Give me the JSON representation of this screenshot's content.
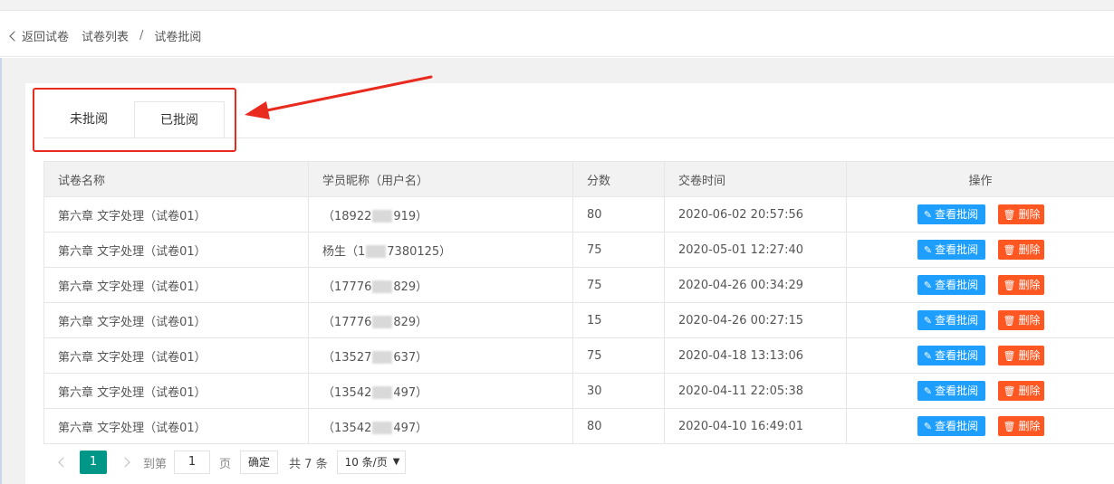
{
  "breadcrumb": {
    "back": "返回试卷",
    "list": "试卷列表",
    "separator": "/",
    "current": "试卷批阅"
  },
  "tabs": [
    {
      "label": "未批阅",
      "active": false
    },
    {
      "label": "已批阅",
      "active": true
    }
  ],
  "colors": {
    "view_button": "#1e9fff",
    "delete_button": "#ff5722",
    "current_page": "#009688",
    "annotation": "#e82a1f"
  },
  "table": {
    "headers": [
      "试卷名称",
      "学员昵称（用户名）",
      "分数",
      "交卷时间",
      "操作"
    ],
    "view_label": "查看批阅",
    "delete_label": "删除",
    "view_icon": "pencil-icon",
    "delete_icon": "trash-icon",
    "rows": [
      {
        "name": "第六章 文字处理（试卷01）",
        "user_a": "（18922",
        "user_b": "919）",
        "score": "80",
        "time": "2020-06-02 20:57:56"
      },
      {
        "name": "第六章 文字处理（试卷01）",
        "user_a": "杨生（1",
        "user_b": "7380125）",
        "score": "75",
        "time": "2020-05-01 12:27:40"
      },
      {
        "name": "第六章 文字处理（试卷01）",
        "user_a": "（17776",
        "user_b": "829）",
        "score": "75",
        "time": "2020-04-26 00:34:29"
      },
      {
        "name": "第六章 文字处理（试卷01）",
        "user_a": "（17776",
        "user_b": "829）",
        "score": "15",
        "time": "2020-04-26 00:27:15"
      },
      {
        "name": "第六章 文字处理（试卷01）",
        "user_a": "（13527",
        "user_b": "637）",
        "score": "75",
        "time": "2020-04-18 13:13:06"
      },
      {
        "name": "第六章 文字处理（试卷01）",
        "user_a": "（13542",
        "user_b": "497）",
        "score": "30",
        "time": "2020-04-11 22:05:38"
      },
      {
        "name": "第六章 文字处理（试卷01）",
        "user_a": "（13542",
        "user_b": "497）",
        "score": "80",
        "time": "2020-04-10 16:49:01"
      }
    ]
  },
  "pagination": {
    "current": "1",
    "goto_label": "到第",
    "goto_value": "1",
    "page_label": "页",
    "confirm_label": "确定",
    "total": "共 7 条",
    "page_size": "10 条/页"
  }
}
